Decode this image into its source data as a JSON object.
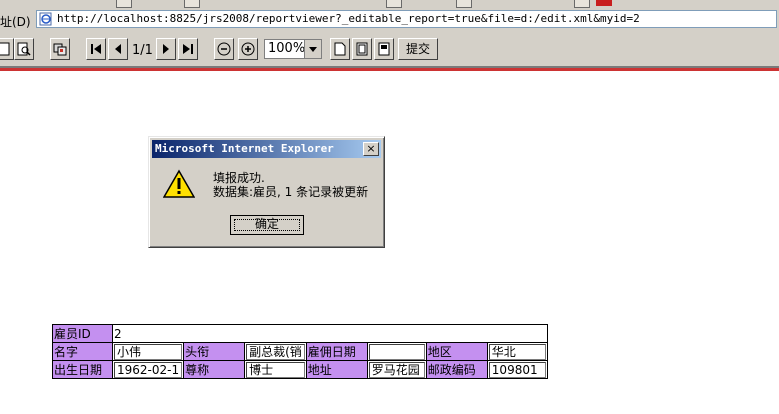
{
  "addressbar": {
    "label": "址(D)",
    "url": "http://localhost:8825/jrs2008/reportviewer?_editable_report=true&file=d:/edit.xml&myid=2"
  },
  "toolbar": {
    "page_indicator": "1/1",
    "zoom": "100%",
    "submit_label": "提交",
    "icons": [
      "save-icon",
      "preview-icon",
      "export-icon",
      "first-page-icon",
      "prev-page-icon",
      "next-page-icon",
      "last-page-icon",
      "zoom-out-icon",
      "zoom-in-icon",
      "page-icon",
      "page-setup-icon",
      "print-icon"
    ]
  },
  "dialog": {
    "title": "Microsoft Internet Explorer",
    "close": "×",
    "line1": "填报成功.",
    "line2": "数据集:雇员, 1 条记录被更新",
    "ok_label": "确定",
    "icon": "warning-icon"
  },
  "report": {
    "row1": {
      "label": "雇员ID",
      "value": "2"
    },
    "row2": [
      {
        "label": "名字",
        "value": "小伟"
      },
      {
        "label": "头衔",
        "value": "副总裁(销"
      },
      {
        "label": "雇佣日期",
        "value": ""
      },
      {
        "label": "地区",
        "value": "华北"
      }
    ],
    "row3": [
      {
        "label": "出生日期",
        "value": "1962-02-1"
      },
      {
        "label": "尊称",
        "value": "博士"
      },
      {
        "label": "地址",
        "value": "罗马花园"
      },
      {
        "label": "邮政编码",
        "value": "109801"
      }
    ],
    "colors": {
      "label_bg": "#c490f0",
      "title_gradient_start": "#0a246a",
      "title_gradient_end": "#a6caf0"
    }
  }
}
